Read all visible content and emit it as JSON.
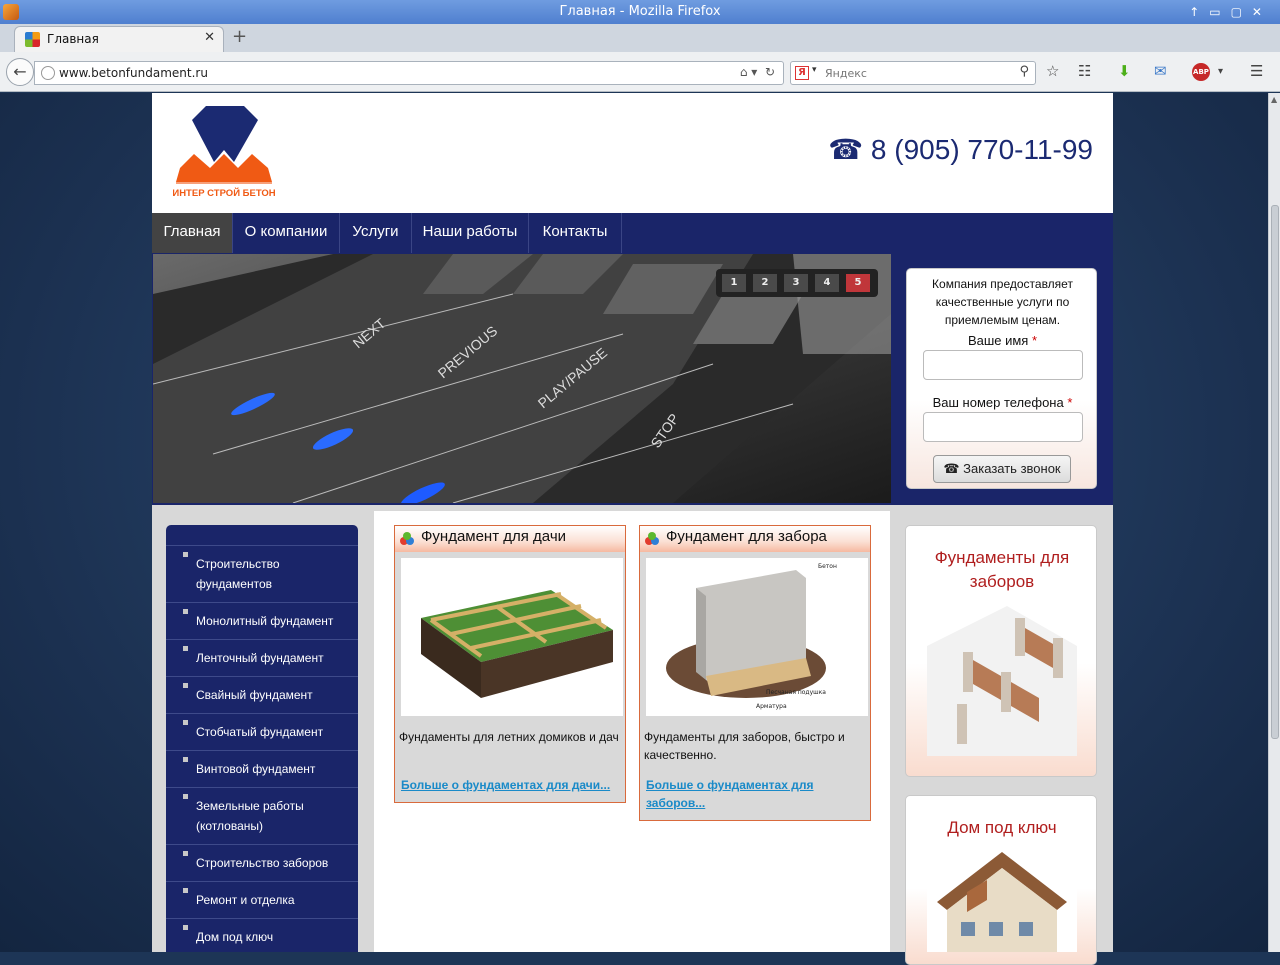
{
  "browser": {
    "window_title": "Главная - Mozilla Firefox",
    "tab_title": "Главная",
    "url": "www.betonfundament.ru",
    "search_placeholder": "Яндекс",
    "search_engine_logo": "Я",
    "close_tab_glyph": "✕",
    "new_tab_glyph": "+"
  },
  "header": {
    "logo_text": "ИНТЕР СТРОЙ БЕТОН",
    "phone": "☎ 8 (905) 770-11-99"
  },
  "menu": [
    "Главная",
    "О компании",
    "Услуги",
    "Наши работы",
    "Контакты"
  ],
  "slider": {
    "pages": [
      "1",
      "2",
      "3",
      "4",
      "5"
    ],
    "current": 5,
    "keys": [
      "NEXT",
      "PREVIOUS",
      "PLAY/PAUSE",
      "STOP"
    ]
  },
  "callback_form": {
    "intro": "Компания предоставляет качественные услуги по приемлемым ценам.",
    "name_label": "Ваше имя",
    "phone_label": "Ваш номер телефона",
    "required_mark": "*",
    "button": "☎ Заказать звонок"
  },
  "sidebar": [
    "Строительство фундаментов",
    "Монолитный фундамент",
    "Ленточный фундамент",
    "Свайный фундамент",
    "Стобчатый фундамент",
    "Винтовой фундамент",
    "Земельные работы (котлованы)",
    "Строительство заборов",
    "Ремонт и отделка",
    "Дом под ключ"
  ],
  "cards": [
    {
      "title": "Фундамент для дачи",
      "description": "Фундаменты для летних домиков и дач",
      "more": "Больше о фундаментах для дачи..."
    },
    {
      "title": "Фундамент для забора",
      "description": "Фундаменты для заборов, быстро и качественно.",
      "more": "Больше о фундаментах для заборов...",
      "diagram_labels": [
        "Бетон",
        "Песчаная подушка",
        "Арматура"
      ]
    }
  ],
  "promos": [
    {
      "title": "Фундаменты для заборов"
    },
    {
      "title": "Дом под ключ"
    }
  ],
  "colors": {
    "brand_blue": "#1a2569",
    "logo_orange": "#f05a14",
    "accent_red": "#b01e1e",
    "link_blue": "#1a8ac8"
  }
}
